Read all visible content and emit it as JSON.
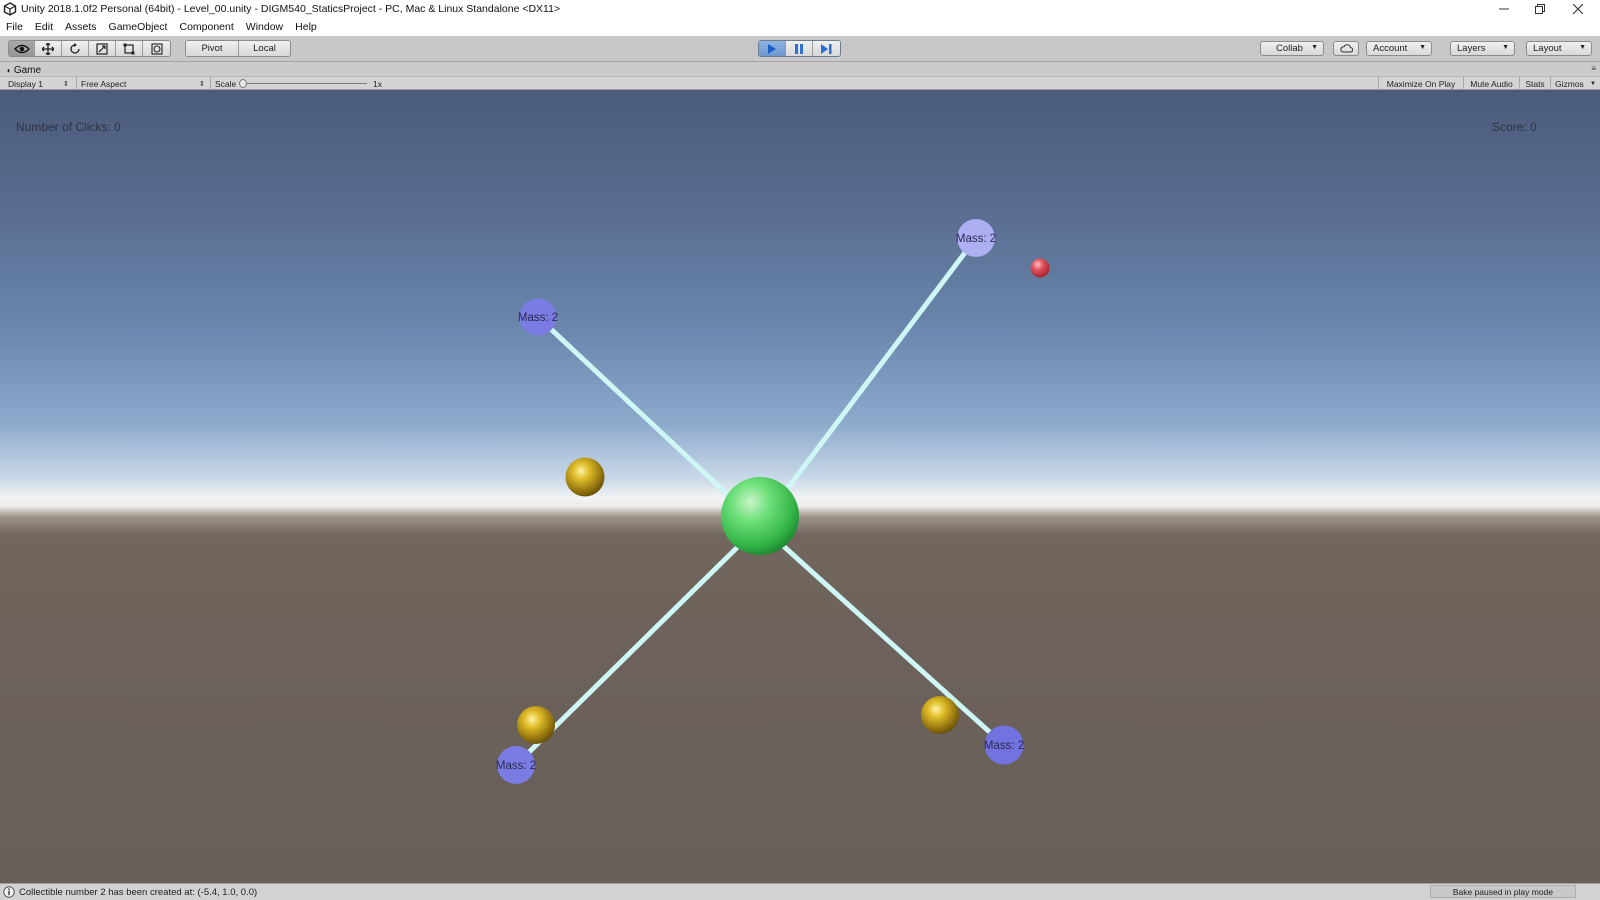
{
  "window": {
    "title": "Unity 2018.1.0f2 Personal (64bit) - Level_00.unity - DIGM540_StaticsProject - PC, Mac & Linux Standalone <DX11>"
  },
  "menu": [
    "File",
    "Edit",
    "Assets",
    "GameObject",
    "Component",
    "Window",
    "Help"
  ],
  "toolbar": {
    "tools": [
      "view-tool",
      "move-tool",
      "rotate-tool",
      "scale-tool",
      "rect-tool",
      "transform-tool"
    ],
    "pivot_label": "Pivot",
    "local_label": "Local",
    "collab_label": "Collab",
    "account_label": "Account",
    "layers_label": "Layers",
    "layout_label": "Layout"
  },
  "game_panel": {
    "tab_label": "Game",
    "display": "Display 1",
    "aspect": "Free Aspect",
    "scale_label": "Scale",
    "scale_value": "1x",
    "scale_fraction": 0.0,
    "maximize_label": "Maximize On Play",
    "mute_label": "Mute Audio",
    "stats_label": "Stats",
    "gizmos_label": "Gizmos"
  },
  "hud": {
    "clicks": "Number of Clicks: 0",
    "score": "Score: 0"
  },
  "scene": {
    "mass_labels": [
      "Mass: 2",
      "Mass: 2",
      "Mass: 2",
      "Mass: 2"
    ]
  },
  "status": {
    "message": "Collectible number 2 has been created at: (-5.4, 1.0, 0.0)",
    "bake": "Bake paused in play mode"
  },
  "colors": {
    "accent_play": "#4a8ad8",
    "rod": "#c8f4f4",
    "mass_node": "#7b7be4",
    "center_ball": "#5ed96a",
    "collectible": "#c8a41e",
    "red_ball": "#e04a55"
  }
}
